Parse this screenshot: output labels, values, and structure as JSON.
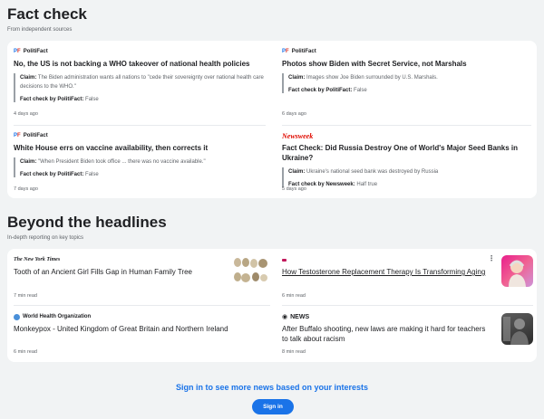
{
  "fact_check": {
    "title": "Fact check",
    "subtitle": "From independent sources",
    "items": [
      {
        "source": "PolitiFact",
        "headline": "No, the US is not backing a WHO takeover of national health policies",
        "claim_label": "Claim:",
        "claim_text": "The Biden administration wants all nations to \"cede their sovereignty over national health care decisions to the WHO.\"",
        "verdict_label": "Fact check by PolitiFact:",
        "verdict": "False",
        "age": "4 days ago"
      },
      {
        "source": "PolitiFact",
        "headline": "Photos show Biden with Secret Service, not Marshals",
        "claim_label": "Claim:",
        "claim_text": "Images show Joe Biden surrounded by U.S. Marshals.",
        "verdict_label": "Fact check by PolitiFact:",
        "verdict": "False",
        "age": "6 days ago"
      },
      {
        "source": "PolitiFact",
        "headline": "White House errs on vaccine availability, then corrects it",
        "claim_label": "Claim:",
        "claim_text": "\"When President Biden took office ... there was no vaccine available.\"",
        "verdict_label": "Fact check by PolitiFact:",
        "verdict": "False",
        "age": "7 days ago"
      },
      {
        "source": "Newsweek",
        "headline": "Fact Check: Did Russia Destroy One of World's Major Seed Banks in Ukraine?",
        "claim_label": "Claim:",
        "claim_text": "Ukraine's national seed bank was destroyed by Russia",
        "verdict_label": "Fact check by Newsweek:",
        "verdict": "Half true",
        "age": "5 days ago"
      }
    ]
  },
  "beyond": {
    "title": "Beyond the headlines",
    "subtitle": "In-depth reporting on key topics",
    "items": [
      {
        "source": "The New York Times",
        "headline": "Tooth of an Ancient Girl Fills Gap in Human Family Tree",
        "read_time": "7 min read"
      },
      {
        "source": "",
        "headline": "How Testosterone Replacement Therapy Is Transforming Aging",
        "read_time": "6 min read"
      },
      {
        "source": "World Health Organization",
        "headline": "Monkeypox - United Kingdom of Great Britain and Northern Ireland",
        "read_time": "6 min read"
      },
      {
        "source": "NEWS",
        "headline": "After Buffalo shooting, new laws are making it hard for teachers to talk about racism",
        "read_time": "8 min read"
      }
    ]
  },
  "signin": {
    "prompt": "Sign in to see more news based on your interests",
    "button": "Sign in"
  },
  "colors": {
    "accent": "#1a73e8",
    "newsweek": "#e00b00",
    "background": "#f1f3f4"
  }
}
